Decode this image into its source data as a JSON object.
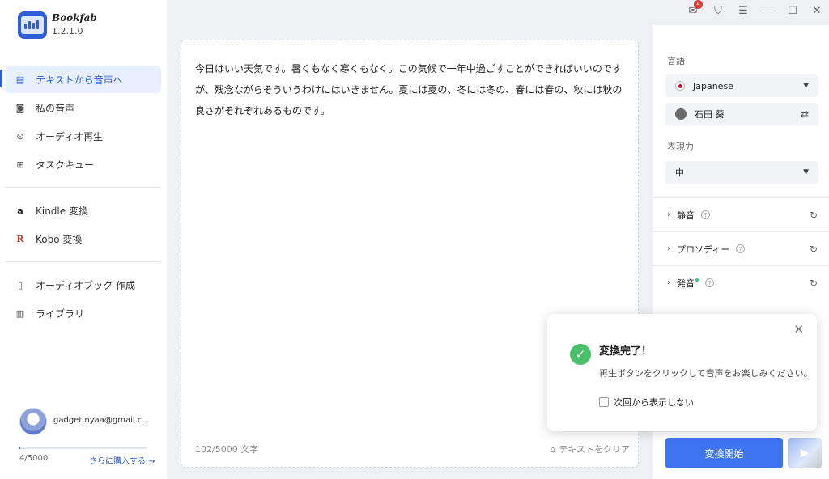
{
  "app": {
    "name": "Bookfab",
    "version": "1.2.1.0",
    "accent": "#2f5fd8"
  },
  "titlebar": {
    "mail_badge": "4",
    "icons": [
      "mail-icon",
      "shirt-icon",
      "menu-icon",
      "minimize-icon",
      "maximize-icon",
      "close-icon"
    ]
  },
  "sidebar": {
    "items": [
      {
        "label": "テキストから音声へ",
        "icon": "document-icon",
        "active": true
      },
      {
        "label": "私の音声",
        "icon": "voice-icon"
      },
      {
        "label": "オーディオ再生",
        "icon": "play-icon"
      },
      {
        "label": "タスクキュー",
        "icon": "queue-icon"
      },
      {
        "label": "Kindle 変換",
        "icon": "kindle-icon"
      },
      {
        "label": "Kobo 変換",
        "icon": "kobo-icon"
      },
      {
        "label": "オーディオブック 作成",
        "icon": "book-icon"
      },
      {
        "label": "ライブラリ",
        "icon": "library-icon"
      }
    ],
    "user": {
      "email": "gadget.nyaa@gmail.c..."
    },
    "quota": {
      "text": "4/5000",
      "fraction": 0.0008,
      "buy_label": "さらに購入する →"
    }
  },
  "editor": {
    "text": "今日はいい天気です。暑くもなく寒くもなく。この気候で一年中過ごすことができればいいのですが、残念ながらそういうわけにはいきません。夏には夏の、冬には冬の、春には春の、秋には秋の良さがそれぞれあるものです。",
    "char_count": "102/5000 文字",
    "clear_label": "テキストをクリア"
  },
  "panel": {
    "language_label": "言語",
    "language_value": "Japanese",
    "voice_value": "石田 葵",
    "expressiveness_label": "表現力",
    "expressiveness_value": "中",
    "sections": [
      {
        "label": "静音"
      },
      {
        "label": "プロソディー"
      },
      {
        "label": "発音"
      }
    ],
    "convert_label": "変換開始"
  },
  "toast": {
    "title": "変換完了！",
    "message": "再生ボタンをクリックして音声をお楽しみください。",
    "checkbox_label": "次回から表示しない"
  }
}
